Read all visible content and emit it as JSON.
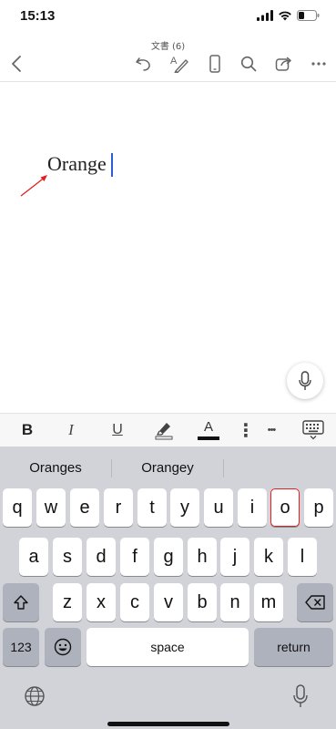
{
  "status_bar": {
    "time": "15:13"
  },
  "header": {
    "doc_title": "文書 (6)"
  },
  "document": {
    "text": "Orange"
  },
  "format_bar": {
    "bold": "B",
    "italic": "I",
    "underline": "U",
    "font_color": "A",
    "more": "⋮",
    "overflow": "•••"
  },
  "keyboard": {
    "suggestions": [
      "Oranges",
      "Orangey",
      ""
    ],
    "row1": [
      "q",
      "w",
      "e",
      "r",
      "t",
      "y",
      "u",
      "i",
      "o",
      "p"
    ],
    "row2": [
      "a",
      "s",
      "d",
      "f",
      "g",
      "h",
      "j",
      "k",
      "l"
    ],
    "row3": [
      "z",
      "x",
      "c",
      "v",
      "b",
      "n",
      "m"
    ],
    "numbers_label": "123",
    "space_label": "space",
    "return_label": "return",
    "highlighted_key": "o"
  },
  "colors": {
    "caret": "#2e5bd6",
    "annotation": "#e02020",
    "keyboard_bg": "#d1d3d9"
  }
}
